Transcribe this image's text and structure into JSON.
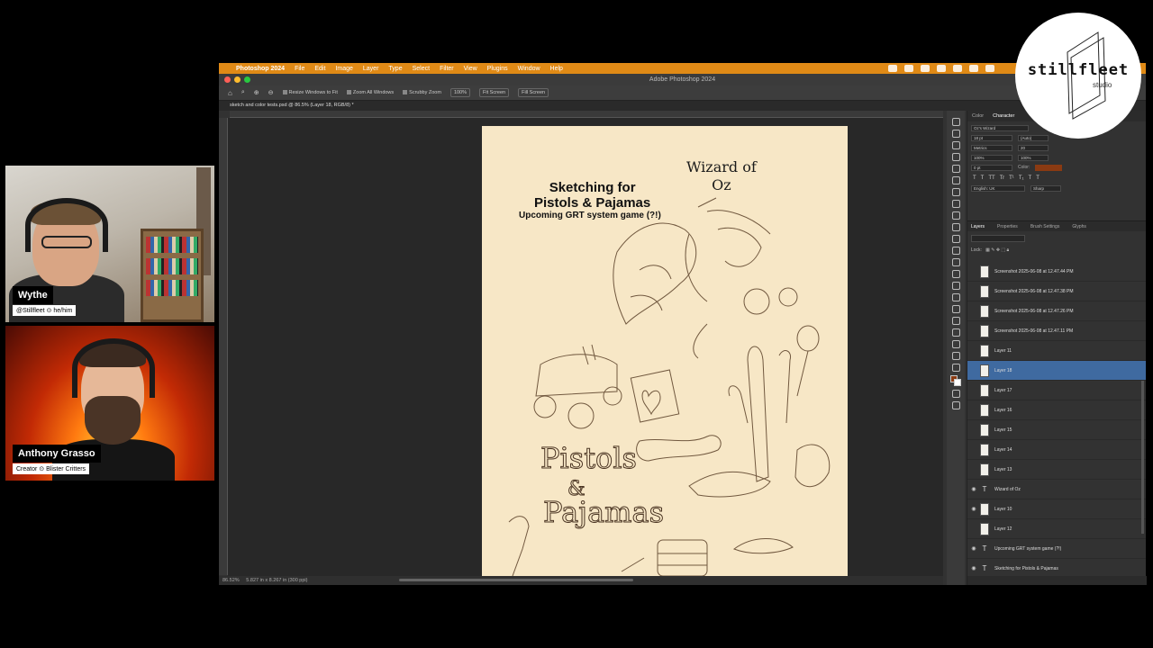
{
  "webcams": [
    {
      "name": "Wythe",
      "subtitle": "@Stillfleet ⊙ he/him"
    },
    {
      "name": "Anthony Grasso",
      "subtitle": "Creator ⊙ Blister Critters"
    }
  ],
  "logo": {
    "text": "stillfleet",
    "sub": "studio"
  },
  "menubar": {
    "app": "Photoshop 2024",
    "items": [
      "File",
      "Edit",
      "Image",
      "Layer",
      "Type",
      "Select",
      "Filter",
      "View",
      "Plugins",
      "Window",
      "Help"
    ]
  },
  "window_title": "Adobe Photoshop 2024",
  "options_bar": {
    "resize": "Resize Windows to Fit",
    "zoom_all": "Zoom All Windows",
    "scrubby": "Scrubby Zoom",
    "zoom_value": "100%",
    "fit": "Fit Screen",
    "fill": "Fill Screen"
  },
  "doc_tab": "sketch and color tests.psd @ 86.5% (Layer 18, RGB/8) *",
  "document": {
    "title_line1": "Sketching for",
    "title_line2": "Pistols & Pajamas",
    "subtitle": "Upcoming GRT system game (?!)",
    "woz_line1": "Wizard of",
    "woz_line2": "Oz",
    "art_text_1": "Pistols",
    "art_text_2": "&",
    "art_text_3": "Pajamas"
  },
  "status": {
    "zoom": "86.52%",
    "size": "5.827 in x 8.267 in (300 ppi)"
  },
  "char_panel": {
    "tabs": [
      "Color",
      "Character"
    ],
    "font": "Oz's Wizard",
    "size": "18 pt",
    "leading": "(Auto)",
    "tracking": "Metrics",
    "kerning": "20",
    "scale_v": "100%",
    "scale_h": "100%",
    "baseline": "0 pt",
    "color_label": "Color:",
    "language": "English: UK",
    "aa": "Sharp",
    "style_buttons": [
      "T",
      "T",
      "TT",
      "Tr",
      "T¹",
      "T₁",
      "T",
      "T"
    ]
  },
  "layers_panel": {
    "tabs": [
      "Layers",
      "Properties",
      "Brush Settings",
      "Glyphs"
    ],
    "lock_label": "Lock:",
    "layers": [
      {
        "name": "Screenshot 2025-06-08 at 12.47.44 PM",
        "type": "image",
        "visible": false,
        "selected": false
      },
      {
        "name": "Screenshot 2025-06-08 at 12.47.38 PM",
        "type": "image",
        "visible": false,
        "selected": false
      },
      {
        "name": "Screenshot 2025-06-08 at 12.47.26 PM",
        "type": "image",
        "visible": false,
        "selected": false
      },
      {
        "name": "Screenshot 2025-06-08 at 12.47.11 PM",
        "type": "image",
        "visible": false,
        "selected": false
      },
      {
        "name": "Layer 11",
        "type": "image",
        "visible": false,
        "selected": false
      },
      {
        "name": "Layer 18",
        "type": "image",
        "visible": false,
        "selected": true
      },
      {
        "name": "Layer 17",
        "type": "image",
        "visible": false,
        "selected": false
      },
      {
        "name": "Layer 16",
        "type": "image",
        "visible": false,
        "selected": false
      },
      {
        "name": "Layer 15",
        "type": "image",
        "visible": false,
        "selected": false
      },
      {
        "name": "Layer 14",
        "type": "image",
        "visible": false,
        "selected": false
      },
      {
        "name": "Layer 13",
        "type": "image",
        "visible": false,
        "selected": false
      },
      {
        "name": "Wizard of Oz",
        "type": "text",
        "visible": true,
        "selected": false
      },
      {
        "name": "Layer 10",
        "type": "image",
        "visible": true,
        "selected": false
      },
      {
        "name": "Layer 12",
        "type": "image",
        "visible": false,
        "selected": false
      },
      {
        "name": "Upcoming GRT system game (?!)",
        "type": "text",
        "visible": true,
        "selected": false
      },
      {
        "name": "Sketching for Pistols & Pajamas",
        "type": "text",
        "visible": true,
        "selected": false
      }
    ]
  },
  "colors": {
    "menubar": "#e08a16",
    "selected_layer": "#3f6aa0",
    "paper": "#f7e7c6",
    "fg_swatch": "#8a3a12"
  }
}
